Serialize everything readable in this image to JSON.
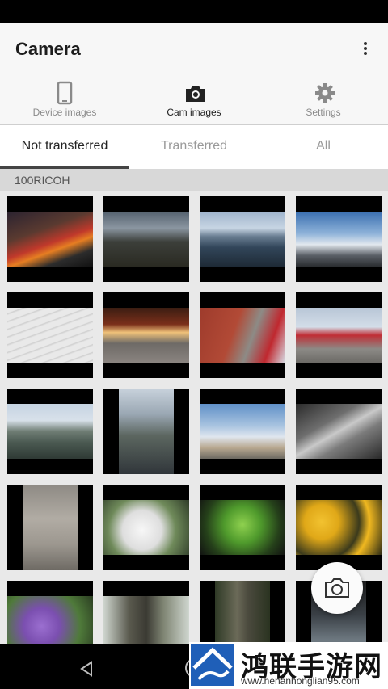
{
  "app": {
    "title": "Camera"
  },
  "nav": [
    {
      "label": "Device images",
      "icon": "phone-icon",
      "active": false
    },
    {
      "label": "Cam images",
      "icon": "camera-icon",
      "active": true
    },
    {
      "label": "Settings",
      "icon": "gear-icon",
      "active": false
    }
  ],
  "tabs": [
    {
      "label": "Not transferred",
      "active": true
    },
    {
      "label": "Transferred",
      "active": false
    },
    {
      "label": "All",
      "active": false
    }
  ],
  "folder": {
    "name": "100RICOH"
  },
  "thumbnails": [
    "night-city-lights",
    "waterfront-buildings-dusk",
    "harbor-boats",
    "bridge-railing-sky",
    "snowy-steps",
    "shrine-lanterns-night",
    "red-railing-stairs",
    "red-bridge",
    "river-boats",
    "tunnel-portrait",
    "street-lamp-tower",
    "rain-drops",
    "carved-wall",
    "white-flowers",
    "green-maple-leaves",
    "yellow-flowers",
    "purple-flowers",
    "tree-trunks",
    "forest-tree",
    "stairway-night"
  ],
  "fab": {
    "icon": "camera-icon"
  },
  "system_nav": {
    "icons": [
      "back-icon",
      "home-icon",
      "recent-apps-icon"
    ]
  },
  "watermark": {
    "title": "鸿联手游网",
    "url": "www.henanhonglian95.com"
  }
}
